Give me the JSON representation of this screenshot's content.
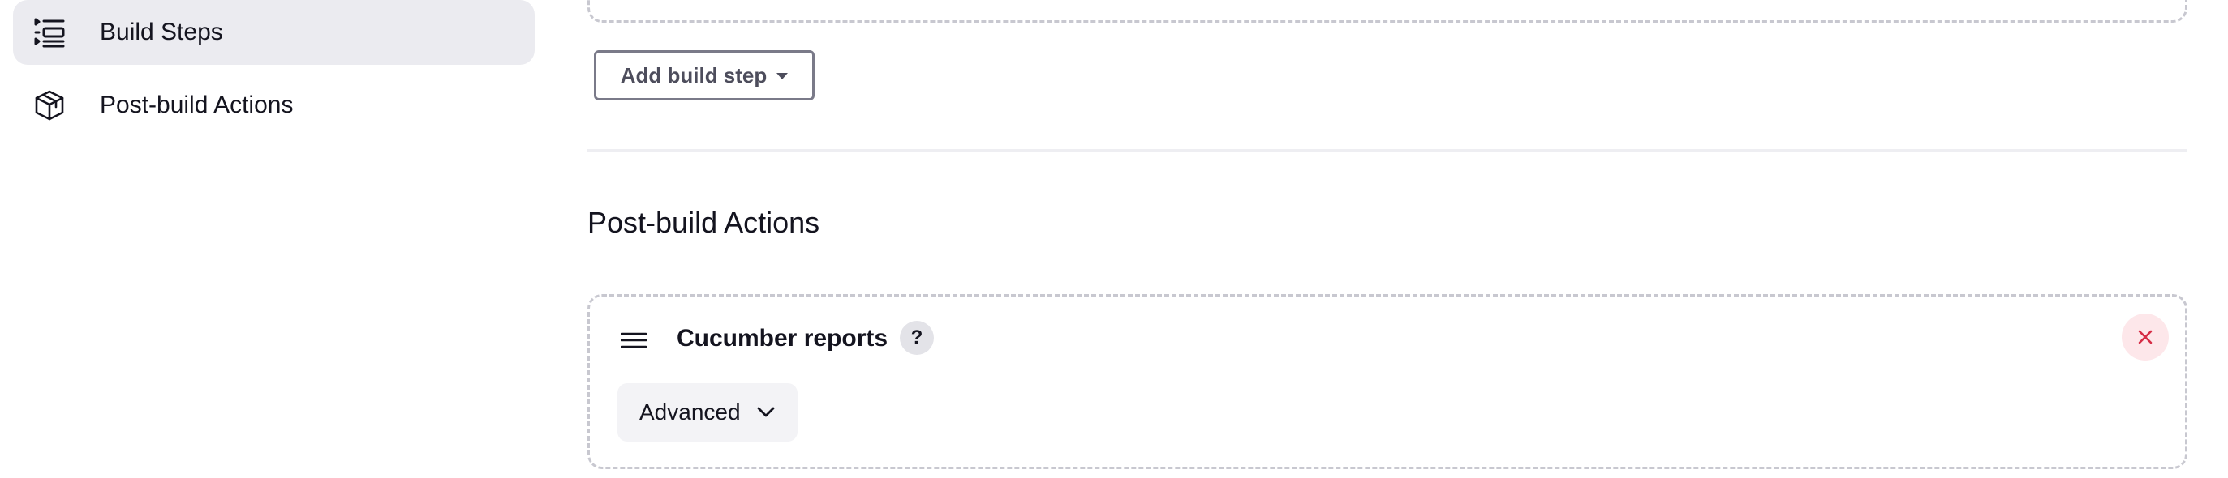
{
  "sidebar": {
    "items": [
      {
        "label": "Build Steps",
        "icon": "list-steps-icon",
        "active": true
      },
      {
        "label": "Post-build Actions",
        "icon": "package-icon",
        "active": false
      }
    ]
  },
  "build_steps": {
    "add_button_label": "Add build step"
  },
  "post_build": {
    "section_title": "Post-build Actions",
    "card": {
      "title": "Cucumber reports",
      "help_label": "?",
      "advanced_label": "Advanced"
    }
  },
  "colors": {
    "sidebar_active_bg": "#ebebf0",
    "close_button_bg": "#fde7ea",
    "close_icon": "#d62d46",
    "dashed_border": "#c8c8d0"
  }
}
